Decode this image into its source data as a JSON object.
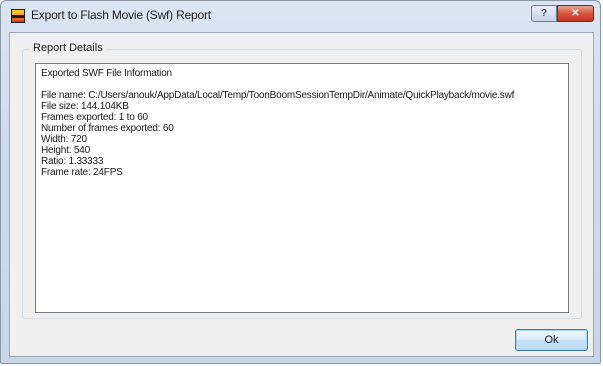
{
  "window": {
    "title": "Export to Flash Movie (Swf) Report"
  },
  "titlebar_buttons": {
    "help_glyph": "?",
    "close_glyph": "✕"
  },
  "group": {
    "label": "Report Details"
  },
  "report": {
    "heading": "Exported SWF File Information",
    "lines": [
      "File name: C:/Users/anouk/AppData/Local/Temp/ToonBoomSessionTempDir/Animate/QuickPlayback/movie.swf",
      "File size: 144.104KB",
      "Frames exported: 1 to 60",
      "Number of frames exported: 60",
      "Width: 720",
      "Height: 540",
      "Ratio: 1.33333",
      "Frame rate: 24FPS"
    ]
  },
  "buttons": {
    "ok_label": "Ok"
  }
}
